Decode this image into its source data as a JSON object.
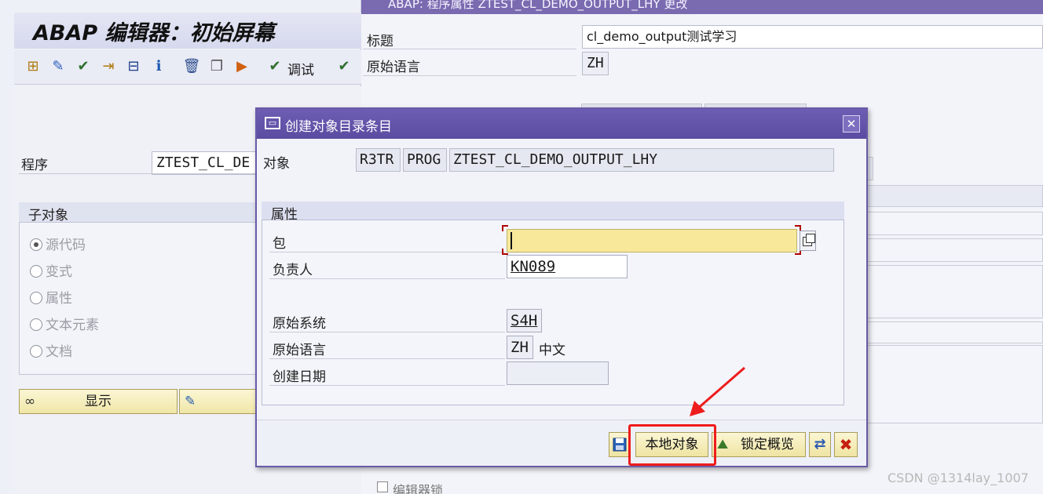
{
  "editor_window": {
    "title": "ABAP 编辑器：初始屏幕",
    "debug_label": "调试",
    "program_label": "程序",
    "program_value": "ZTEST_CL_DE",
    "subobjects_title": "子对象",
    "subobjects": [
      {
        "label": "源代码",
        "selected": true
      },
      {
        "label": "变式",
        "selected": false
      },
      {
        "label": "属性",
        "selected": false
      },
      {
        "label": "文本元素",
        "selected": false
      },
      {
        "label": "文档",
        "selected": false
      }
    ],
    "display_button": "显示"
  },
  "attributes_window": {
    "title_bar": "ABAP: 程序属性 ZTEST_CL_DEMO_OUTPUT_LHY 更改",
    "title_label": "标题",
    "title_value": "cl_demo_output测试学习",
    "orig_lang_label": "原始语言",
    "orig_lang_value": "ZH",
    "editor_lock_label": "编辑器锁"
  },
  "dialog": {
    "title": "创建对象目录条目",
    "object_label": "对象",
    "object_pgmid": "R3TR",
    "object_type": "PROG",
    "object_name": "ZTEST_CL_DEMO_OUTPUT_LHY",
    "attributes_title": "属性",
    "package_label": "包",
    "package_value": "",
    "responsible_label": "负责人",
    "responsible_value": "KN089",
    "orig_system_label": "原始系统",
    "orig_system_value": "S4H",
    "orig_lang_label": "原始语言",
    "orig_lang_value": "ZH",
    "orig_lang_text": "中文",
    "created_date_label": "创建日期",
    "created_date_value": "",
    "buttons": {
      "local_object": "本地对象",
      "lock_overview": "锁定概览"
    }
  },
  "watermark": "CSDN @1314lay_1007",
  "colors": {
    "title_bar": "#5b4ba1",
    "highlight": "#ee1c1c",
    "required_field": "#f7e89a"
  }
}
